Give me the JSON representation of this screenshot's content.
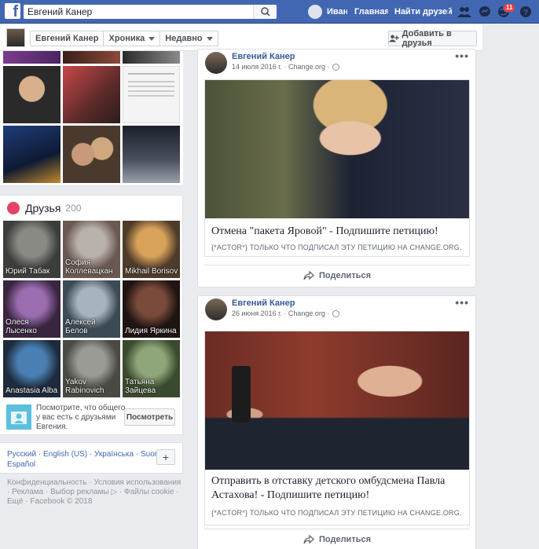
{
  "topbar": {
    "search_value": "Евгений Канер",
    "user_name": "Иван",
    "home_label": "Главная",
    "find_friends_label": "Найти друзей",
    "notifications_count": "11"
  },
  "profile_bar": {
    "menu": [
      "Евгений Канер",
      "Хроника",
      "Недавно"
    ],
    "add_friend_label": "Добавить в друзья"
  },
  "friends": {
    "title": "Друзья",
    "count": "200",
    "tiles": [
      {
        "name": "Юрий Табак",
        "c1": "#8a8a84",
        "c2": "#3d3d3a"
      },
      {
        "name": "София Коллевацкан",
        "c1": "#b9b1ab",
        "c2": "#6a5851"
      },
      {
        "name": "Mikhail Borisov",
        "c1": "#d9a25a",
        "c2": "#4f3b2a"
      },
      {
        "name": "Олеся Лысенко",
        "c1": "#9a6db0",
        "c2": "#3a2540"
      },
      {
        "name": "Алексей Белов",
        "c1": "#a7b4bf",
        "c2": "#3b4a55"
      },
      {
        "name": "Лидия Яркина",
        "c1": "#7a4a3a",
        "c2": "#1e1412"
      },
      {
        "name": "Anastasia Alba",
        "c1": "#4a7fb3",
        "c2": "#1d2b3d"
      },
      {
        "name": "Yakov Rabinovich",
        "c1": "#9b9b95",
        "c2": "#4a4a44"
      },
      {
        "name": "Татьяна Зайцева",
        "c1": "#8fa67a",
        "c2": "#3a4a2e"
      }
    ],
    "prompt_text": "Посмотрите, что общего у вас есть с друзьями Евгения.",
    "prompt_button": "Посмотреть"
  },
  "languages": {
    "line1": "Русский · English (US) · Українська · Suomi ·",
    "line2": "Español",
    "plus": "+"
  },
  "footer": {
    "text": "Конфиденциальность · Условия использования · Реклама · Выбор рекламы ▷ · Файлы cookie · Ещё · Facebook © 2018"
  },
  "posts": [
    {
      "author": "Евгений Канер",
      "date": "14 июля 2016 г.",
      "source": "Change.org",
      "title": "Отмена \"пакета Яровой\" - Подпишите петицию!",
      "subtitle": "{*ACTOR*} ТОЛЬКО ЧТО ПОДПИСАЛ ЭТУ ПЕТИЦИЮ НА CHANGE.ORG.",
      "share_label": "Поделиться"
    },
    {
      "author": "Евгений Канер",
      "date": "26 июня 2016 г.",
      "source": "Change.org",
      "title": "Отправить в отставку детского омбудсмена Павла Астахова! - Подпишите петицию!",
      "subtitle": "{*ACTOR*} ТОЛЬКО ЧТО ПОДПИСАЛ ЭТУ ПЕТИЦИЮ НА CHANGE.ORG.",
      "share_label": "Поделиться"
    }
  ],
  "colors": {
    "brand_blue": "#4267b2",
    "link_blue": "#365899",
    "badge_red": "#fa3e3e"
  }
}
